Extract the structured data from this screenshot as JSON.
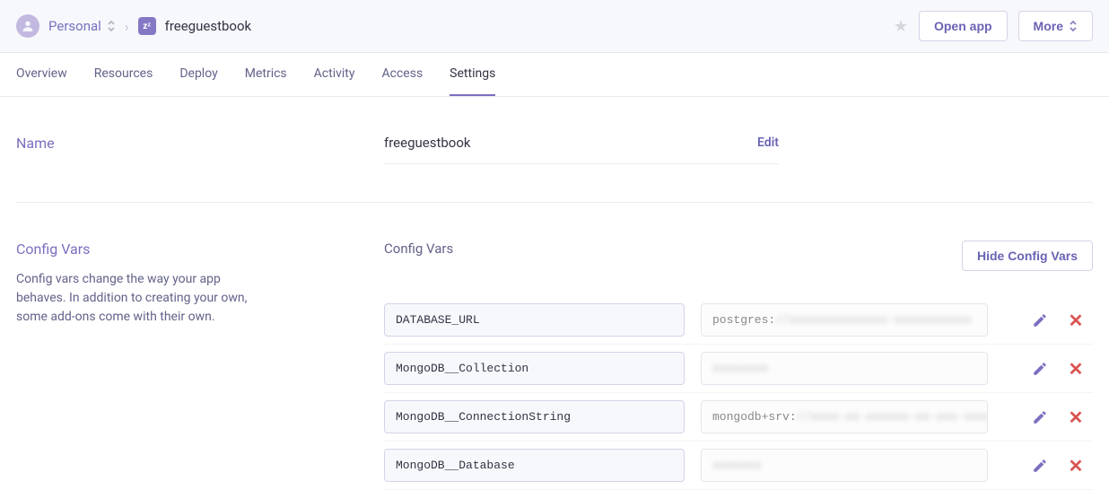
{
  "header": {
    "workspace": "Personal",
    "app_name": "freeguestbook",
    "open_app_label": "Open app",
    "more_label": "More"
  },
  "tabs": [
    {
      "label": "Overview",
      "active": false
    },
    {
      "label": "Resources",
      "active": false
    },
    {
      "label": "Deploy",
      "active": false
    },
    {
      "label": "Metrics",
      "active": false
    },
    {
      "label": "Activity",
      "active": false
    },
    {
      "label": "Access",
      "active": false
    },
    {
      "label": "Settings",
      "active": true
    }
  ],
  "name_section": {
    "title": "Name",
    "value": "freeguestbook",
    "edit_label": "Edit"
  },
  "config_section": {
    "title": "Config Vars",
    "description": "Config vars change the way your app behaves. In addition to creating your own, some add-ons come with their own.",
    "right_label": "Config Vars",
    "hide_button": "Hide Config Vars",
    "vars": [
      {
        "key": "DATABASE_URL",
        "prefix": "postgres:",
        "hidden": "//xxxxxxxxxxxxxx-xxxxxxxxxxx"
      },
      {
        "key": "MongoDB__Collection",
        "prefix": "",
        "hidden": "xxxxxxxx"
      },
      {
        "key": "MongoDB__ConnectionString",
        "prefix": "mongodb+srv:",
        "hidden": "//xxxx-xx-xxxxxx-xx-xxx-xxxxx"
      },
      {
        "key": "MongoDB__Database",
        "prefix": "",
        "hidden": "xxxxxxx"
      }
    ]
  }
}
